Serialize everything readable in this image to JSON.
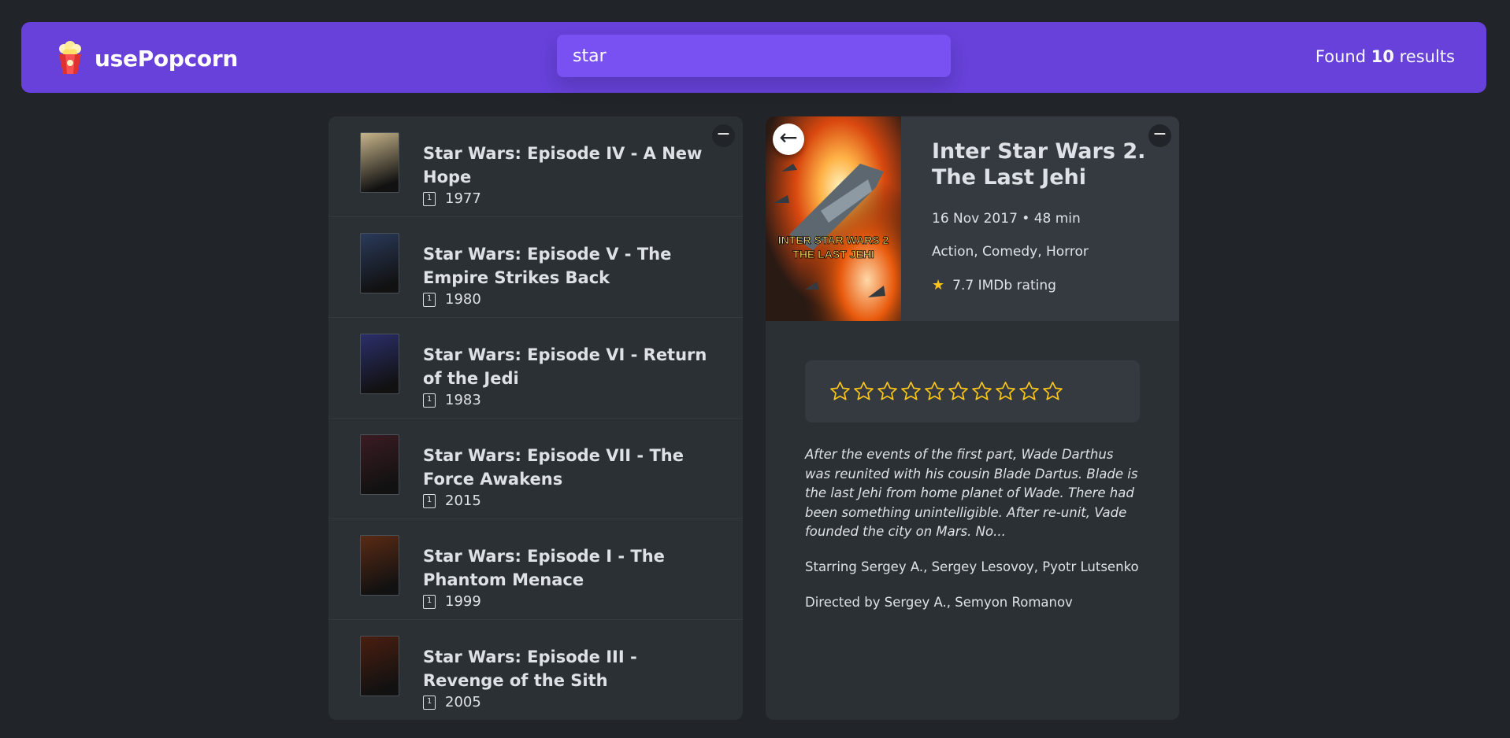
{
  "nav": {
    "logo_text": "usePopcorn",
    "search_value": "star",
    "found_prefix": "Found ",
    "found_count": "10",
    "found_suffix": " results"
  },
  "list": {
    "toggle_label": "−",
    "movies": [
      {
        "title": "Star Wars: Episode IV - A New Hope",
        "year": "1977",
        "poster_color": "#c7b48a"
      },
      {
        "title": "Star Wars: Episode V - The Empire Strikes Back",
        "year": "1980",
        "poster_color": "#2a3a5a"
      },
      {
        "title": "Star Wars: Episode VI - Return of the Jedi",
        "year": "1983",
        "poster_color": "#2b2f6a"
      },
      {
        "title": "Star Wars: Episode VII - The Force Awakens",
        "year": "2015",
        "poster_color": "#3a1c22"
      },
      {
        "title": "Star Wars: Episode I - The Phantom Menace",
        "year": "1999",
        "poster_color": "#5a2a14"
      },
      {
        "title": "Star Wars: Episode III - Revenge of the Sith",
        "year": "2005",
        "poster_color": "#4a1e10"
      }
    ]
  },
  "detail": {
    "toggle_label": "−",
    "back_label": "←",
    "title": "Inter Star Wars 2. The Last Jehi",
    "poster_text_line1": "INTER STAR WARS 2",
    "poster_text_line2": "THE LAST JEHI",
    "released_runtime": "16 Nov 2017 • 48 min",
    "genre": "Action, Comedy, Horror",
    "imdb_rating": "7.7 IMDb rating",
    "rating_star_count": 10,
    "plot": "After the events of the first part, Wade Darthus was reunited with his cousin Blade Dartus. Blade is the last Jehi from home planet of Wade. There had been something unintelligible. After re-unit, Vade founded the city on Mars. No...",
    "starring": "Starring Sergey A., Sergey Lesovoy, Pyotr Lutsenko",
    "directed": "Directed by Sergey A., Semyon Romanov"
  },
  "colors": {
    "background": "#212529",
    "nav": "#6741d9",
    "search": "#7950f2",
    "box": "#2b3035",
    "star": "#fcc419"
  },
  "icons": {
    "logo": "popcorn-icon",
    "year": "calendar-icon",
    "rating": "star-icon",
    "back": "arrow-left-icon"
  }
}
